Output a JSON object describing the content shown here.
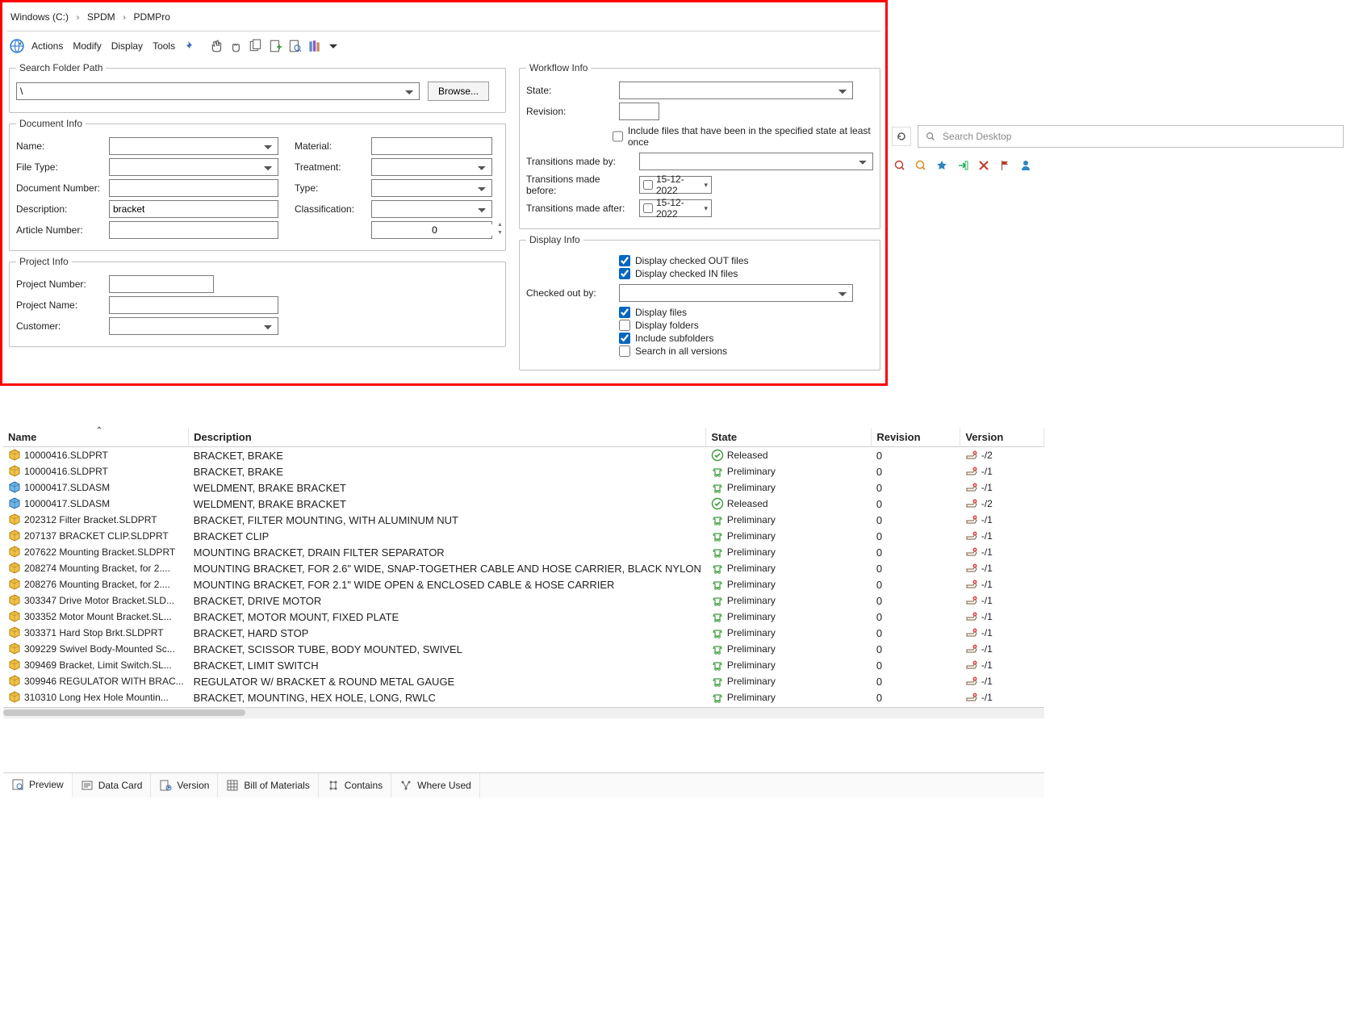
{
  "breadcrumb": {
    "parts": [
      "Windows  (C:)",
      "SPDM",
      "PDMPro"
    ]
  },
  "toolbar_menus": {
    "actions": "Actions",
    "modify": "Modify",
    "display": "Display",
    "tools": "Tools"
  },
  "search_folder": {
    "legend": "Search Folder Path",
    "value": "\\",
    "browse": "Browse..."
  },
  "document_info": {
    "legend": "Document Info",
    "name_label": "Name:",
    "filetype_label": "File Type:",
    "docnum_label": "Document Number:",
    "desc_label": "Description:",
    "desc_value": "bracket",
    "artnum_label": "Article Number:",
    "material_label": "Material:",
    "treatment_label": "Treatment:",
    "type_label": "Type:",
    "classification_label": "Classification:",
    "spinner_value": "0"
  },
  "project_info": {
    "legend": "Project Info",
    "projnum_label": "Project Number:",
    "projname_label": "Project Name:",
    "customer_label": "Customer:"
  },
  "workflow_info": {
    "legend": "Workflow Info",
    "state_label": "State:",
    "revision_label": "Revision:",
    "include_once_label": "Include files that have been in the specified state at least once",
    "trans_by_label": "Transitions made by:",
    "trans_before_label": "Transitions made before:",
    "trans_after_label": "Transitions made after:",
    "date_before": "15-12-2022",
    "date_after": "15-12-2022"
  },
  "display_info": {
    "legend": "Display Info",
    "display_out_label": "Display checked OUT files",
    "display_in_label": "Display checked IN files",
    "checked_by_label": "Checked out by:",
    "display_files_label": "Display files",
    "display_folders_label": "Display folders",
    "include_sub_label": "Include subfolders",
    "search_all_label": "Search in all versions"
  },
  "browser_search_placeholder": "Search Desktop",
  "columns": {
    "name": "Name",
    "desc": "Description",
    "state": "State",
    "rev": "Revision",
    "ver": "Version"
  },
  "rows": [
    {
      "icon": "part",
      "name": "10000416.SLDPRT",
      "desc": "BRACKET, BRAKE",
      "state_icon": "released",
      "state": "Released",
      "rev": "0",
      "ver": "-/2"
    },
    {
      "icon": "part",
      "name": "10000416.SLDPRT",
      "desc": "BRACKET, BRAKE",
      "state_icon": "prelim",
      "state": "Preliminary",
      "rev": "0",
      "ver": "-/1"
    },
    {
      "icon": "asm",
      "name": "10000417.SLDASM",
      "desc": "WELDMENT, BRAKE BRACKET",
      "state_icon": "prelim",
      "state": "Preliminary",
      "rev": "0",
      "ver": "-/1"
    },
    {
      "icon": "asm",
      "name": "10000417.SLDASM",
      "desc": "WELDMENT, BRAKE BRACKET",
      "state_icon": "released",
      "state": "Released",
      "rev": "0",
      "ver": "-/2"
    },
    {
      "icon": "part",
      "name": "202312 Filter Bracket.SLDPRT",
      "desc": "BRACKET, FILTER  MOUNTING, WITH ALUMINUM NUT",
      "state_icon": "prelim",
      "state": "Preliminary",
      "rev": "0",
      "ver": "-/1"
    },
    {
      "icon": "part",
      "name": "207137 BRACKET CLIP.SLDPRT",
      "desc": "BRACKET CLIP",
      "state_icon": "prelim",
      "state": "Preliminary",
      "rev": "0",
      "ver": "-/1"
    },
    {
      "icon": "part",
      "name": "207622 Mounting Bracket.SLDPRT",
      "desc": "MOUNTING BRACKET, DRAIN FILTER SEPARATOR",
      "state_icon": "prelim",
      "state": "Preliminary",
      "rev": "0",
      "ver": "-/1"
    },
    {
      "icon": "part",
      "name": "208274 Mounting Bracket, for 2....",
      "desc": "MOUNTING BRACKET, FOR 2.6\" WIDE, SNAP-TOGETHER CABLE AND HOSE CARRIER, BLACK NYLON",
      "state_icon": "prelim",
      "state": "Preliminary",
      "rev": "0",
      "ver": "-/1"
    },
    {
      "icon": "part",
      "name": "208276 Mounting Bracket, for 2....",
      "desc": "MOUNTING BRACKET, FOR 2.1\" WIDE OPEN & ENCLOSED CABLE & HOSE CARRIER",
      "state_icon": "prelim",
      "state": "Preliminary",
      "rev": "0",
      "ver": "-/1"
    },
    {
      "icon": "part",
      "name": "303347 Drive Motor Bracket.SLD...",
      "desc": "BRACKET, DRIVE MOTOR",
      "state_icon": "prelim",
      "state": "Preliminary",
      "rev": "0",
      "ver": "-/1"
    },
    {
      "icon": "part",
      "name": "303352 Motor Mount Bracket.SL...",
      "desc": "BRACKET, MOTOR MOUNT, FIXED PLATE",
      "state_icon": "prelim",
      "state": "Preliminary",
      "rev": "0",
      "ver": "-/1"
    },
    {
      "icon": "part",
      "name": "303371 Hard Stop Brkt.SLDPRT",
      "desc": "BRACKET, HARD STOP",
      "state_icon": "prelim",
      "state": "Preliminary",
      "rev": "0",
      "ver": "-/1"
    },
    {
      "icon": "part",
      "name": "309229 Swivel Body-Mounted Sc...",
      "desc": "BRACKET, SCISSOR TUBE, BODY MOUNTED, SWIVEL",
      "state_icon": "prelim",
      "state": "Preliminary",
      "rev": "0",
      "ver": "-/1"
    },
    {
      "icon": "part",
      "name": "309469 Bracket, Limit Switch.SL...",
      "desc": "BRACKET, LIMIT SWITCH",
      "state_icon": "prelim",
      "state": "Preliminary",
      "rev": "0",
      "ver": "-/1"
    },
    {
      "icon": "part",
      "name": "309946 REGULATOR WITH BRAC...",
      "desc": "REGULATOR W/ BRACKET & ROUND METAL GAUGE",
      "state_icon": "prelim",
      "state": "Preliminary",
      "rev": "0",
      "ver": "-/1"
    },
    {
      "icon": "part",
      "name": "310310 Long Hex Hole Mountin...",
      "desc": "BRACKET, MOUNTING, HEX HOLE, LONG, RWLC",
      "state_icon": "prelim",
      "state": "Preliminary",
      "rev": "0",
      "ver": "-/1"
    }
  ],
  "tabs": {
    "preview": "Preview",
    "datacard": "Data Card",
    "version": "Version",
    "bom": "Bill of Materials",
    "contains": "Contains",
    "whereused": "Where Used"
  }
}
